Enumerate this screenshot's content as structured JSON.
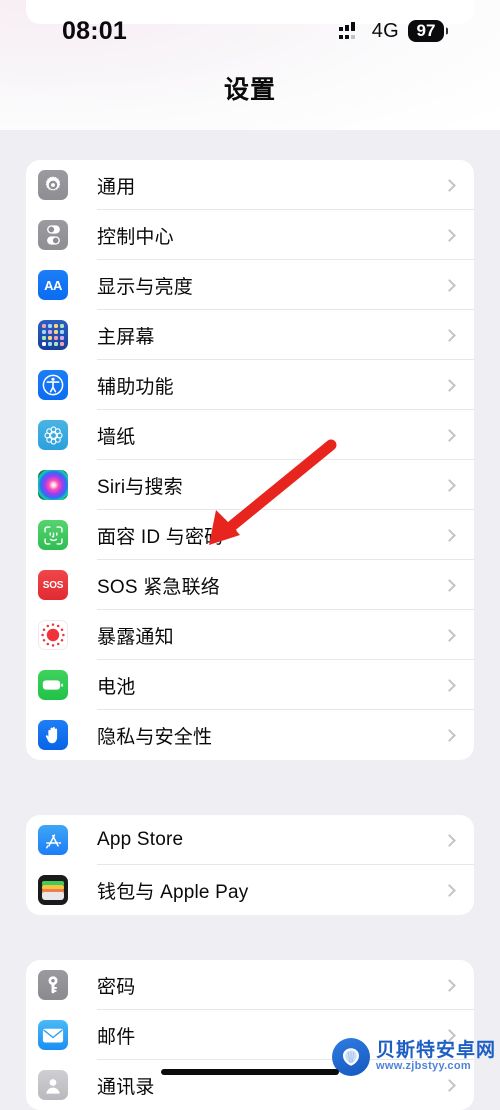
{
  "status_bar": {
    "time": "08:01",
    "network_label": "4G",
    "battery_percent": "97",
    "signal_icon": "cellular-signal-icon"
  },
  "nav": {
    "title": "设置"
  },
  "groups": [
    {
      "id": "group-system",
      "rows": [
        {
          "label": "通用",
          "icon": "gear-icon"
        },
        {
          "label": "控制中心",
          "icon": "control-center-icon"
        },
        {
          "label": "显示与亮度",
          "icon": "display-brightness-icon"
        },
        {
          "label": "主屏幕",
          "icon": "home-screen-icon"
        },
        {
          "label": "辅助功能",
          "icon": "accessibility-icon"
        },
        {
          "label": "墙纸",
          "icon": "wallpaper-icon"
        },
        {
          "label": "Siri与搜索",
          "icon": "siri-icon"
        },
        {
          "label": "面容 ID 与密码",
          "icon": "face-id-icon"
        },
        {
          "label": "SOS 紧急联络",
          "icon": "sos-icon"
        },
        {
          "label": "暴露通知",
          "icon": "exposure-notification-icon"
        },
        {
          "label": "电池",
          "icon": "battery-icon"
        },
        {
          "label": "隐私与安全性",
          "icon": "privacy-security-icon"
        }
      ]
    },
    {
      "id": "group-store",
      "rows": [
        {
          "label": "App Store",
          "icon": "app-store-icon"
        },
        {
          "label": "钱包与 Apple Pay",
          "icon": "wallet-icon"
        }
      ]
    },
    {
      "id": "group-accounts",
      "rows": [
        {
          "label": "密码",
          "icon": "passwords-key-icon"
        },
        {
          "label": "邮件",
          "icon": "mail-icon"
        },
        {
          "label": "通讯录",
          "icon": "contacts-icon"
        }
      ]
    }
  ],
  "annotation": {
    "type": "red-arrow",
    "color": "#e8241f",
    "points_to": "面容 ID 与密码"
  },
  "watermark": {
    "site_name": "贝斯特安卓网",
    "site_url": "www.zjbstyy.com"
  },
  "sos_icon_text": "SOS",
  "aa_icon_text": "AA",
  "colors": {
    "page_background": "#eeeef3",
    "card_background": "#ffffff",
    "separator": "#e7e7ea",
    "chevron": "#c4c4c8",
    "primary_text": "#0a0a0b",
    "accent_blue": "#0a6cf1",
    "accent_green": "#2fbe52",
    "accent_red": "#e02a31",
    "annotation_red": "#e8241f"
  }
}
